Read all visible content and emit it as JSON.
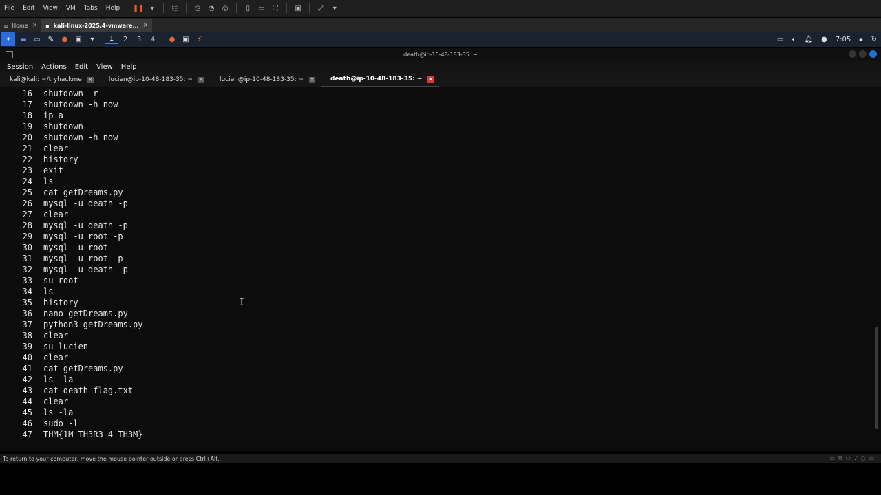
{
  "vmware": {
    "menu": [
      "File",
      "Edit",
      "View",
      "VM",
      "Tabs",
      "Help"
    ],
    "tabs": [
      {
        "label": "Home",
        "close": "×"
      },
      {
        "label": "kali-linux-2025.4-vmware...",
        "close": "×"
      }
    ],
    "status_text": "To return to your computer, move the mouse pointer outside or press Ctrl+Alt."
  },
  "kali_panel": {
    "workspaces": [
      "1",
      "2",
      "3",
      "4"
    ],
    "clock": "7:05"
  },
  "terminal": {
    "title": "death@ip-10-48-183-35: ~",
    "menu": [
      "Session",
      "Actions",
      "Edit",
      "View",
      "Help"
    ],
    "tabs": [
      {
        "label": "kali@kali: ~/tryhackme",
        "close": "×"
      },
      {
        "label": "lucien@ip-10-48-183-35: ~",
        "close": "×"
      },
      {
        "label": "lucien@ip-10-48-183-35: ~",
        "close": "×"
      },
      {
        "label": "death@ip-10-48-183-35: ~",
        "close": "×"
      }
    ],
    "lines": [
      {
        "n": "16",
        "cmd": "shutdown -r"
      },
      {
        "n": "17",
        "cmd": "shutdown -h now"
      },
      {
        "n": "18",
        "cmd": "ip a"
      },
      {
        "n": "19",
        "cmd": "shutdown"
      },
      {
        "n": "20",
        "cmd": "shutdown -h now"
      },
      {
        "n": "21",
        "cmd": "clear"
      },
      {
        "n": "22",
        "cmd": "history"
      },
      {
        "n": "23",
        "cmd": "exit"
      },
      {
        "n": "24",
        "cmd": "ls"
      },
      {
        "n": "25",
        "cmd": "cat getDreams.py"
      },
      {
        "n": "26",
        "cmd": "mysql -u death -p"
      },
      {
        "n": "27",
        "cmd": "clear"
      },
      {
        "n": "28",
        "cmd": "mysql -u death -p"
      },
      {
        "n": "29",
        "cmd": "mysql -u root -p"
      },
      {
        "n": "30",
        "cmd": "mysql -u root"
      },
      {
        "n": "31",
        "cmd": "mysql -u root -p"
      },
      {
        "n": "32",
        "cmd": "mysql -u death -p"
      },
      {
        "n": "33",
        "cmd": "su root"
      },
      {
        "n": "34",
        "cmd": "ls"
      },
      {
        "n": "35",
        "cmd": "history"
      },
      {
        "n": "36",
        "cmd": "nano getDreams.py"
      },
      {
        "n": "37",
        "cmd": "python3 getDreams.py"
      },
      {
        "n": "38",
        "cmd": "clear"
      },
      {
        "n": "39",
        "cmd": "su lucien"
      },
      {
        "n": "40",
        "cmd": "clear"
      },
      {
        "n": "41",
        "cmd": "cat getDreams.py"
      },
      {
        "n": "42",
        "cmd": "ls -la"
      },
      {
        "n": "43",
        "cmd": "cat death_flag.txt"
      },
      {
        "n": "44",
        "cmd": "clear"
      },
      {
        "n": "45",
        "cmd": "ls -la"
      },
      {
        "n": "46",
        "cmd": "sudo -l"
      },
      {
        "n": "47",
        "cmd": "THM{1M_TH3R3_4_TH3M}"
      }
    ]
  },
  "colors": {
    "terminal_bg": "#0c0c0c",
    "terminal_fg": "#e8e8e8",
    "accent": "#2d8cf0",
    "tab_close_active": "#d23b3b",
    "pause": "#e5572d"
  }
}
